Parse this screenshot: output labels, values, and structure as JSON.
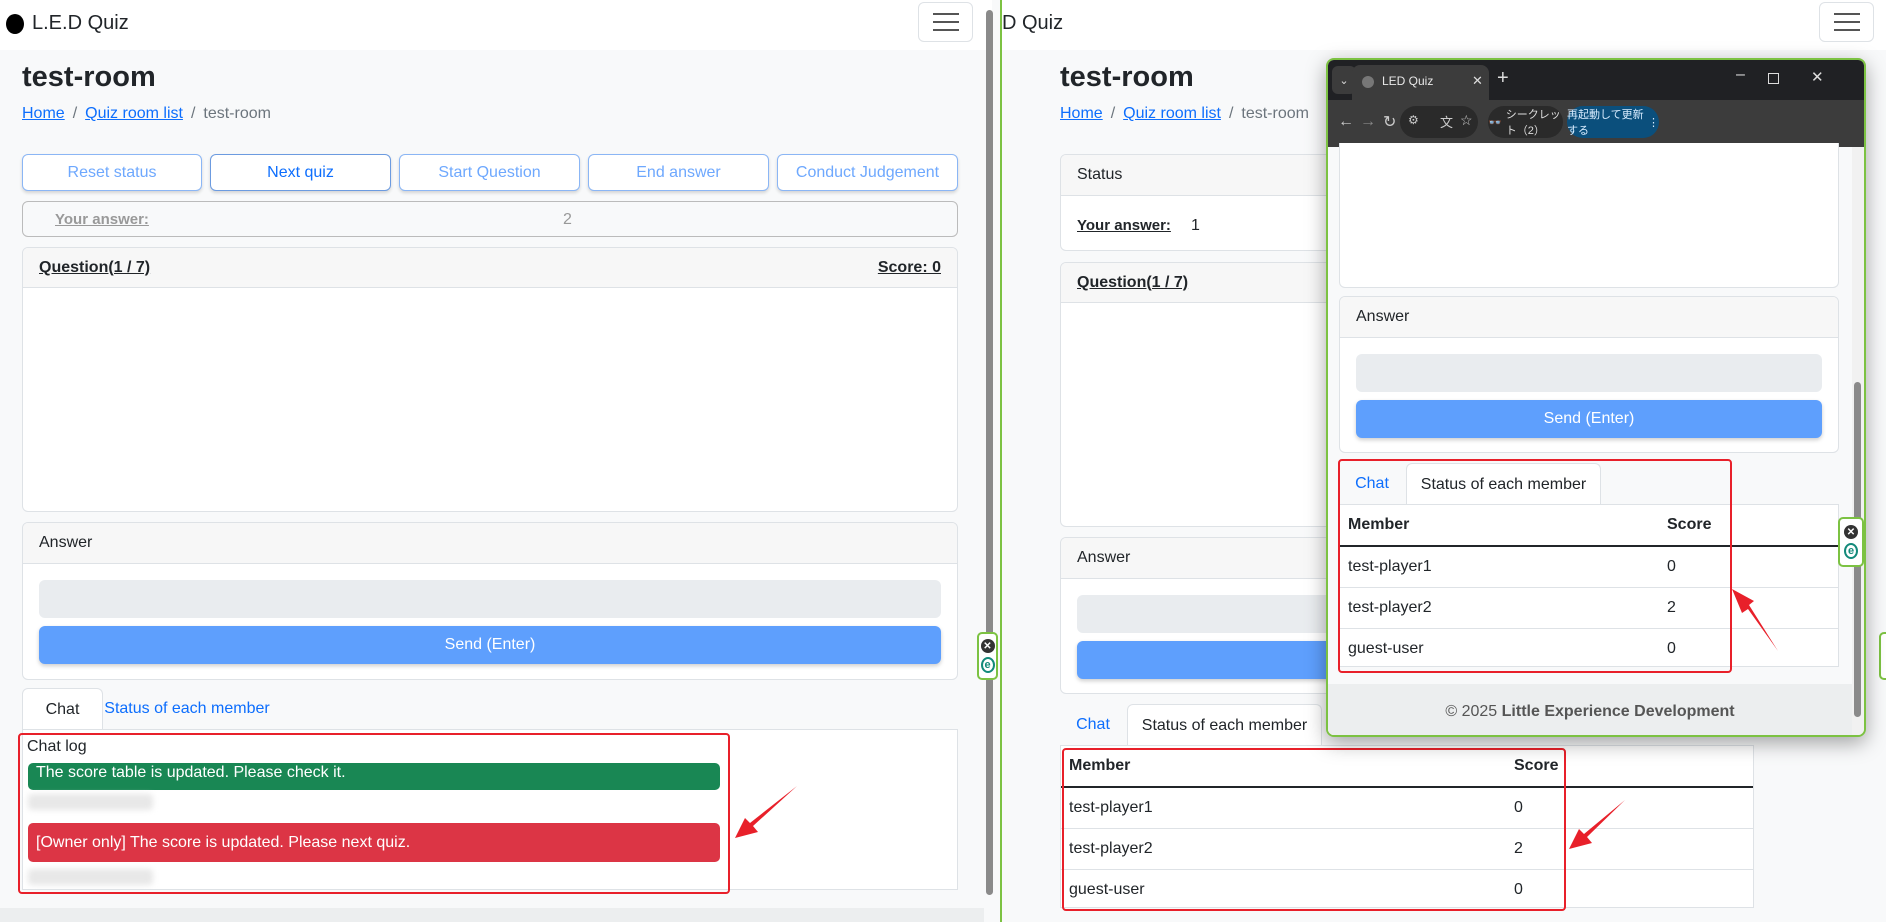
{
  "app": {
    "brand": "L.E.D Quiz",
    "brand_partial": "D Quiz"
  },
  "page": {
    "title": "test-room",
    "breadcrumb": [
      "Home",
      "Quiz room list",
      "test-room"
    ]
  },
  "owner_view": {
    "buttons": [
      "Reset status",
      "Next quiz",
      "Start Question",
      "End answer",
      "Conduct Judgement"
    ],
    "your_answer_label": "Your answer:",
    "your_answer_value": "2",
    "question_label": "Question(1 / 7)",
    "score_label": "Score: 0",
    "answer_header": "Answer",
    "send_label": "Send (Enter)",
    "tabs": [
      "Chat",
      "Status of each member"
    ],
    "active_tab": "Chat",
    "chat_log_label": "Chat log",
    "messages": [
      {
        "text": "The score table is updated. Please check it.",
        "color": "#198754"
      },
      {
        "text": "[Owner only] The score is updated. Please next quiz.",
        "color": "#dc3545"
      }
    ]
  },
  "player_view": {
    "status_header": "Status",
    "your_answer_label": "Your answer:",
    "your_answer_value": "1",
    "question_label": "Question(1 / 7)",
    "answer_header": "Answer",
    "tabs": [
      "Chat",
      "Status of each member"
    ],
    "active_tab": "Status of each member",
    "table": {
      "headers": [
        "Member",
        "Score"
      ],
      "rows": [
        [
          "test-player1",
          "0"
        ],
        [
          "test-player2",
          "2"
        ],
        [
          "guest-user",
          "0"
        ]
      ]
    }
  },
  "popup": {
    "tab_title": "LED Quiz",
    "incognito": "シークレット（2）",
    "update_button": "再起動して更新する",
    "answer_header": "Answer",
    "send_label": "Send (Enter)",
    "tabs": [
      "Chat",
      "Status of each member"
    ],
    "active_tab": "Status of each member",
    "table": {
      "headers": [
        "Member",
        "Score"
      ],
      "rows": [
        [
          "test-player1",
          "0"
        ],
        [
          "test-player2",
          "2"
        ],
        [
          "guest-user",
          "0"
        ]
      ]
    },
    "footer_prefix": "© 2025 ",
    "footer_org": "Little Experience Development"
  },
  "colors": {
    "accent": "#0d6efd",
    "annotation": "#e8202a",
    "window_border": "#7cc242"
  }
}
